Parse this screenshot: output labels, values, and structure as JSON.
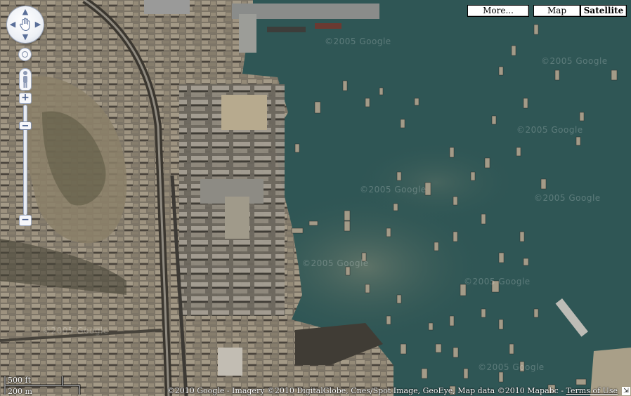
{
  "map": {
    "type": "satellite",
    "map_types": [
      {
        "label": "More...",
        "active": false
      },
      {
        "label": "Map",
        "active": false
      },
      {
        "label": "Satellite",
        "active": true
      }
    ],
    "watermark_text": "©2005 Google",
    "scale": {
      "imperial": "500 ft",
      "metric": "200 m"
    },
    "copyright": {
      "text": "©2010 Google - Imagery ©2010 DigitalGlobe, Cnes/Spot Image, GeoEye, Map data ©2010 Mapabc - ",
      "terms_link": "Terms of Use"
    },
    "colors": {
      "water": "#2e5553",
      "land": "#7f7868",
      "control_accent": "#5a6f99"
    },
    "icons": {
      "pan": "hand-icon",
      "street_view": "pegman-icon",
      "zoom_in": "plus-icon",
      "zoom_out": "minus-icon",
      "resize": "resize-corner-icon"
    }
  }
}
